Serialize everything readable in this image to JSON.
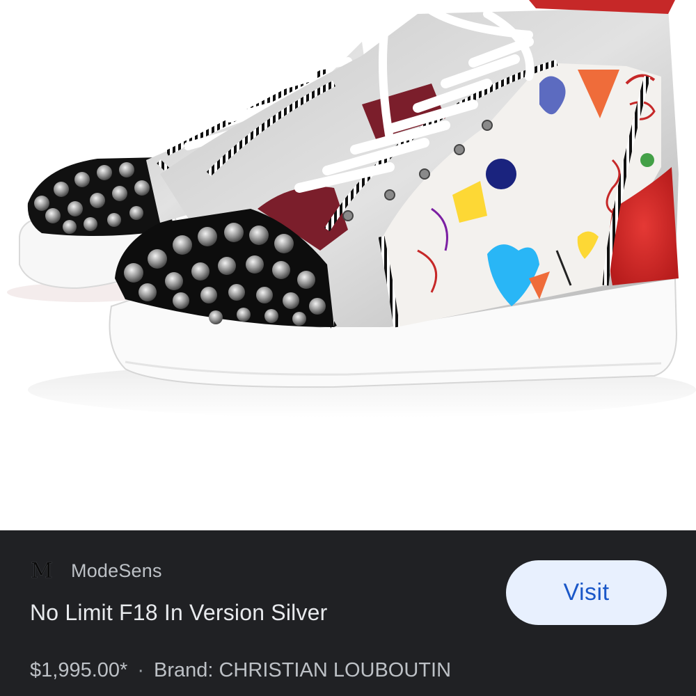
{
  "source": {
    "logo_letter": "M",
    "name": "ModeSens"
  },
  "product": {
    "title": "No Limit F18 In Version Silver",
    "price": "$1,995.00*",
    "separator": "·",
    "brand": "Brand: CHRISTIAN LOUBOUTIN"
  },
  "visit_button": {
    "label": "Visit"
  },
  "colors": {
    "panel_background": "#202124",
    "button_background": "#e8f0fe",
    "button_text": "#1a57c8"
  }
}
